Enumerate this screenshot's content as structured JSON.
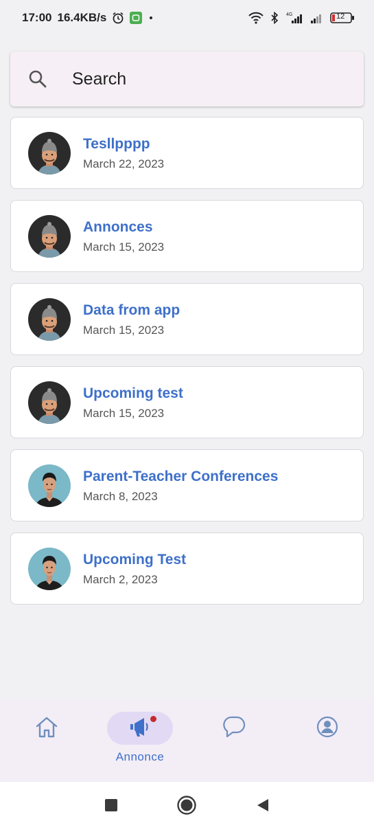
{
  "status_bar": {
    "time": "17:00",
    "speed": "16.4KB/s",
    "network_label": "4G",
    "battery": "12",
    "icons": [
      "alarm-icon",
      "app-notification-icon",
      "wifi-icon",
      "bluetooth-icon",
      "signal-icon",
      "battery-icon"
    ]
  },
  "search": {
    "placeholder": "Search"
  },
  "announcements": [
    {
      "title": "Tesllpppp",
      "date": "March 22, 2023",
      "avatar": "avatar-beanie"
    },
    {
      "title": "Annonces",
      "date": "March 15, 2023",
      "avatar": "avatar-beanie"
    },
    {
      "title": "Data from app",
      "date": "March 15, 2023",
      "avatar": "avatar-beanie"
    },
    {
      "title": "Upcoming test",
      "date": "March 15, 2023",
      "avatar": "avatar-beanie"
    },
    {
      "title": "Parent-Teacher Conferences",
      "date": "March 8, 2023",
      "avatar": "avatar-photo"
    },
    {
      "title": "Upcoming Test",
      "date": "March 2, 2023",
      "avatar": "avatar-photo"
    }
  ],
  "bottom_nav": {
    "items": [
      {
        "id": "home",
        "icon": "home-icon",
        "label": ""
      },
      {
        "id": "annonce",
        "icon": "megaphone-icon",
        "label": "Annonce",
        "active": true
      },
      {
        "id": "chat",
        "icon": "chat-icon",
        "label": ""
      },
      {
        "id": "profile",
        "icon": "profile-icon",
        "label": ""
      }
    ]
  },
  "colors": {
    "accent": "#3e70c9",
    "background": "#f1f1f3",
    "nav_background": "#f3edf6",
    "active_pill": "#e2d9f4",
    "badge": "#c42b2b"
  }
}
